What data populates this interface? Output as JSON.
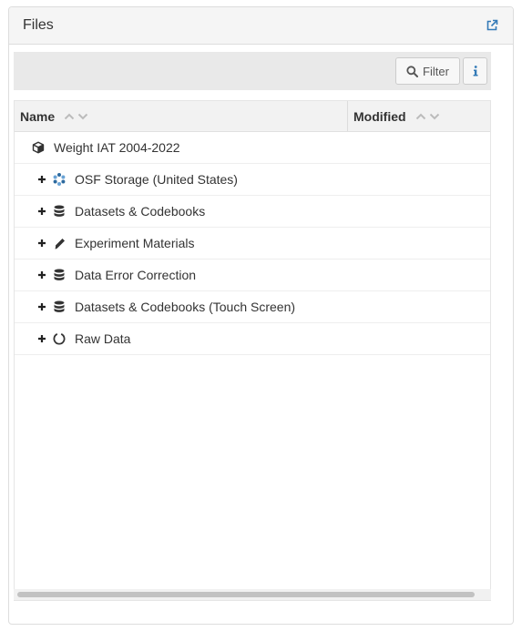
{
  "panel": {
    "title": "Files"
  },
  "toolbar": {
    "filter_label": "Filter"
  },
  "grid": {
    "columns": {
      "name": "Name",
      "modified": "Modified"
    },
    "root": {
      "label": "Weight IAT 2004-2022",
      "icon": "cube-icon"
    },
    "items": [
      {
        "label": "OSF Storage (United States)",
        "icon": "osf-storage-icon"
      },
      {
        "label": "Datasets & Codebooks",
        "icon": "database-icon"
      },
      {
        "label": "Experiment Materials",
        "icon": "pencil-icon"
      },
      {
        "label": "Data Error Correction",
        "icon": "database-icon"
      },
      {
        "label": "Datasets & Codebooks (Touch Screen)",
        "icon": "database-icon"
      },
      {
        "label": "Raw Data",
        "icon": "circle-notch-icon"
      }
    ]
  },
  "colors": {
    "link_blue": "#337ab7",
    "header_bg": "#f5f5f5",
    "toolbar_bg": "#e9e9e9"
  }
}
